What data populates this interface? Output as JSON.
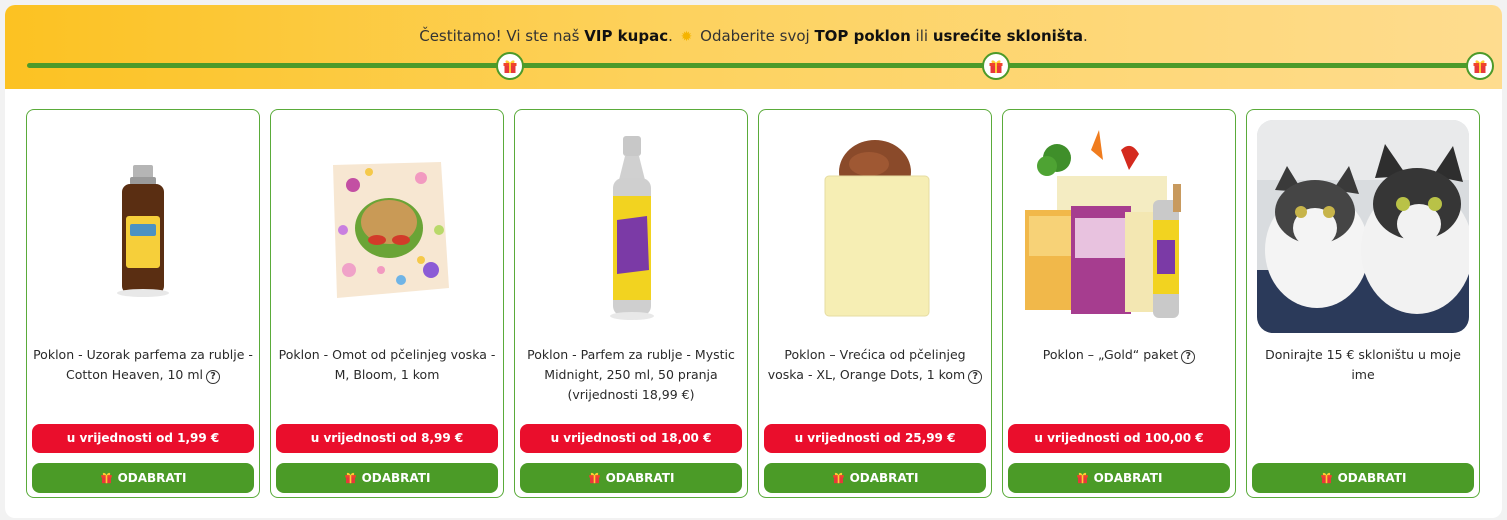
{
  "banner": {
    "text_1": "Čestitamo! Vi ste naš ",
    "vip": "VIP kupac",
    "text_2": ". ",
    "text_3": " Odaberite svoj ",
    "top": "TOP poklon",
    "text_4": " ili ",
    "shelter": "usrećite skloništa",
    "text_5": ".",
    "progress_milestones": 3
  },
  "colors": {
    "accent_green": "#4b9b27",
    "price_red": "#ea0e2c",
    "banner_yellow": "#fcc222"
  },
  "cards": [
    {
      "title": "Poklon - Uzorak parfema za rublje - Cotton Heaven, 10 ml",
      "help": "?",
      "price": "u vrijednosti od 1,99 €",
      "button": "ODABRATI"
    },
    {
      "title": "Poklon - Omot od pčelinjeg voska - M, Bloom, 1 kom",
      "price": "u vrijednosti od 8,99 €",
      "button": "ODABRATI"
    },
    {
      "title": "Poklon - Parfem za rublje - Mystic Midnight, 250 ml, 50 pranja (vrijednosti 18,99 €)",
      "price": "u vrijednosti od 18,00 €",
      "button": "ODABRATI"
    },
    {
      "title": "Poklon – Vrećica od pčelinjeg voska - XL, Orange Dots, 1 kom",
      "help": "?",
      "price": "u vrijednosti od 25,99 €",
      "button": "ODABRATI"
    },
    {
      "title": "Poklon – „Gold“ paket",
      "help": "?",
      "price": "u vrijednosti od 100,00 €",
      "button": "ODABRATI"
    },
    {
      "title": "Donirajte 15 € skloništu u moje ime",
      "button": "ODABRATI"
    }
  ]
}
